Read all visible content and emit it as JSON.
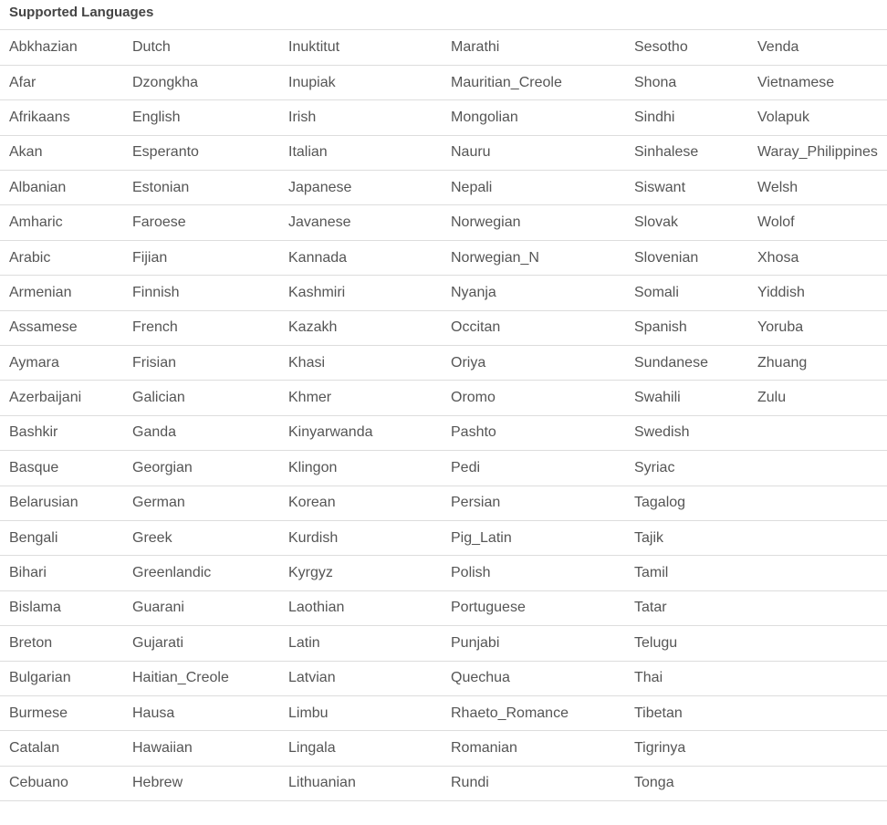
{
  "title": "Supported Languages",
  "rows": [
    [
      "Abkhazian",
      "Dutch",
      "Inuktitut",
      "Marathi",
      "Sesotho",
      "Venda"
    ],
    [
      "Afar",
      "Dzongkha",
      "Inupiak",
      "Mauritian_Creole",
      "Shona",
      "Vietnamese"
    ],
    [
      "Afrikaans",
      "English",
      "Irish",
      "Mongolian",
      "Sindhi",
      "Volapuk"
    ],
    [
      "Akan",
      "Esperanto",
      "Italian",
      "Nauru",
      "Sinhalese",
      "Waray_Philippines"
    ],
    [
      "Albanian",
      "Estonian",
      "Japanese",
      "Nepali",
      "Siswant",
      "Welsh"
    ],
    [
      "Amharic",
      "Faroese",
      "Javanese",
      "Norwegian",
      "Slovak",
      "Wolof"
    ],
    [
      "Arabic",
      "Fijian",
      "Kannada",
      "Norwegian_N",
      "Slovenian",
      "Xhosa"
    ],
    [
      "Armenian",
      "Finnish",
      "Kashmiri",
      "Nyanja",
      "Somali",
      "Yiddish"
    ],
    [
      "Assamese",
      "French",
      "Kazakh",
      "Occitan",
      "Spanish",
      "Yoruba"
    ],
    [
      "Aymara",
      "Frisian",
      "Khasi",
      "Oriya",
      "Sundanese",
      "Zhuang"
    ],
    [
      "Azerbaijani",
      "Galician",
      "Khmer",
      "Oromo",
      "Swahili",
      "Zulu"
    ],
    [
      "Bashkir",
      "Ganda",
      "Kinyarwanda",
      "Pashto",
      "Swedish",
      ""
    ],
    [
      "Basque",
      "Georgian",
      "Klingon",
      "Pedi",
      "Syriac",
      ""
    ],
    [
      "Belarusian",
      "German",
      "Korean",
      "Persian",
      "Tagalog",
      ""
    ],
    [
      "Bengali",
      "Greek",
      "Kurdish",
      "Pig_Latin",
      "Tajik",
      ""
    ],
    [
      "Bihari",
      "Greenlandic",
      "Kyrgyz",
      "Polish",
      "Tamil",
      ""
    ],
    [
      "Bislama",
      "Guarani",
      "Laothian",
      "Portuguese",
      "Tatar",
      ""
    ],
    [
      "Breton",
      "Gujarati",
      "Latin",
      "Punjabi",
      "Telugu",
      ""
    ],
    [
      "Bulgarian",
      "Haitian_Creole",
      "Latvian",
      "Quechua",
      "Thai",
      ""
    ],
    [
      "Burmese",
      "Hausa",
      "Limbu",
      "Rhaeto_Romance",
      "Tibetan",
      ""
    ],
    [
      "Catalan",
      "Hawaiian",
      "Lingala",
      "Romanian",
      "Tigrinya",
      ""
    ],
    [
      "Cebuano",
      "Hebrew",
      "Lithuanian",
      "Rundi",
      "Tonga",
      ""
    ]
  ]
}
